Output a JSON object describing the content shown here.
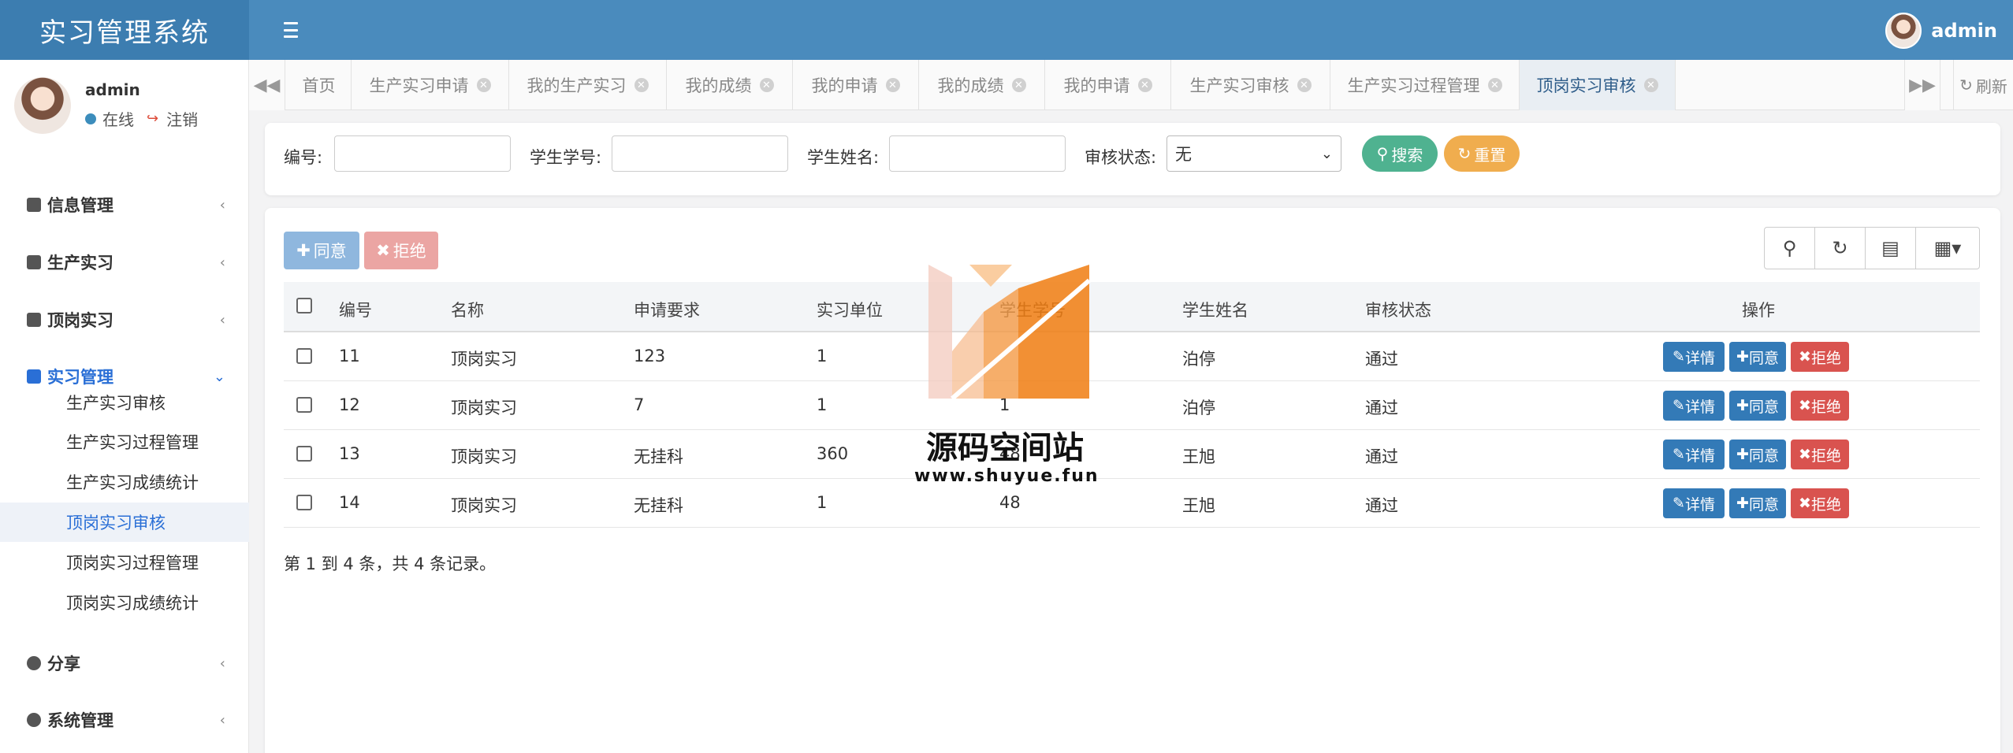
{
  "app": {
    "title": "实习管理系统",
    "user": "admin"
  },
  "sidebar": {
    "profile": {
      "name": "admin",
      "status": "在线",
      "logout": "注销"
    },
    "items": [
      {
        "label": "信息管理",
        "icon": "id-card-icon"
      },
      {
        "label": "生产实习",
        "icon": "user-box-icon"
      },
      {
        "label": "顶岗实习",
        "icon": "card-icon"
      },
      {
        "label": "实习管理",
        "icon": "address-card-icon",
        "active": true
      },
      {
        "label": "分享",
        "icon": "comment-icon"
      },
      {
        "label": "系统管理",
        "icon": "gear-icon"
      }
    ],
    "subitems": [
      "生产实习审核",
      "生产实习过程管理",
      "生产实习成绩统计",
      "顶岗实习审核",
      "顶岗实习过程管理",
      "顶岗实习成绩统计"
    ]
  },
  "tabs": [
    "首页",
    "生产实习申请",
    "我的生产实习",
    "我的成绩",
    "我的申请",
    "我的成绩",
    "我的申请",
    "生产实习审核",
    "生产实习过程管理",
    "顶岗实习审核"
  ],
  "tabs_refresh": "刷新",
  "search": {
    "id_label": "编号:",
    "student_no_label": "学生学号:",
    "student_name_label": "学生姓名:",
    "status_label": "审核状态:",
    "status_value": "无",
    "search_btn": "搜索",
    "reset_btn": "重置"
  },
  "toolbar": {
    "approve": "同意",
    "reject": "拒绝"
  },
  "table": {
    "headers": [
      "编号",
      "名称",
      "申请要求",
      "实习单位",
      "学生学号",
      "学生姓名",
      "审核状态",
      "操作"
    ],
    "rows": [
      {
        "id": "11",
        "name": "顶岗实习",
        "req": "123",
        "unit": "1",
        "stuno": "",
        "stuname": "泊停",
        "status": "通过"
      },
      {
        "id": "12",
        "name": "顶岗实习",
        "req": "7",
        "unit": "1",
        "stuno": "1",
        "stuname": "泊停",
        "status": "通过"
      },
      {
        "id": "13",
        "name": "顶岗实习",
        "req": "无挂科",
        "unit": "360",
        "stuno": "48",
        "stuname": "王旭",
        "status": "通过"
      },
      {
        "id": "14",
        "name": "顶岗实习",
        "req": "无挂科",
        "unit": "1",
        "stuno": "48",
        "stuname": "王旭",
        "status": "通过"
      }
    ],
    "actions": {
      "detail": "详情",
      "approve": "同意",
      "reject": "拒绝"
    },
    "footer": "第 1 到 4 条，共 4 条记录。"
  },
  "watermark": {
    "text": "源码空间站",
    "url": "www.shuyue.fun"
  },
  "colors": {
    "header": "#4a8bbd",
    "brand": "#3c7db0",
    "primary": "#337ab7",
    "danger": "#d9534f",
    "search": "#4fb290",
    "reset": "#f0ad4e"
  }
}
